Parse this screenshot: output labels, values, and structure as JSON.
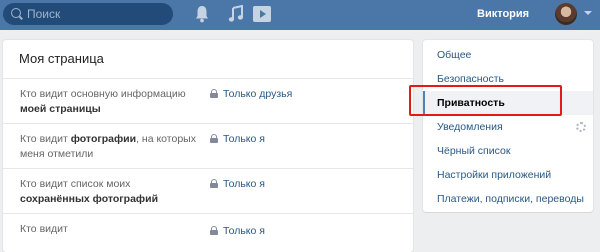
{
  "topbar": {
    "search_placeholder": "Поиск",
    "user_name": "Виктория",
    "icons": [
      "bell-icon",
      "music-icon",
      "play-icon"
    ]
  },
  "main": {
    "title": "Моя страница",
    "rows": [
      {
        "label_plain": "Кто видит основную информацию ",
        "label_bold": "моей страницы",
        "label_after": "",
        "value": "Только друзья"
      },
      {
        "label_plain": "Кто видит ",
        "label_bold": "фотографии",
        "label_after": ", на которых меня отметили",
        "value": "Только я"
      },
      {
        "label_plain": "Кто видит список моих ",
        "label_bold": "сохранённых фотографий",
        "label_after": "",
        "value": "Только я"
      },
      {
        "label_plain": "Кто видит",
        "label_bold": "",
        "label_after": "",
        "value": "Только я"
      }
    ]
  },
  "menu": {
    "items": [
      {
        "label": "Общее"
      },
      {
        "label": "Безопасность"
      },
      {
        "label": "Приватность"
      },
      {
        "label": "Уведомления"
      },
      {
        "label": "Чёрный список"
      },
      {
        "label": "Настройки приложений"
      },
      {
        "label": "Платежи, подписки, переводы"
      }
    ],
    "active_index": 2
  },
  "colors": {
    "topbar": "#4a76a8",
    "link": "#2a5885",
    "highlight": "#e21a1a"
  }
}
